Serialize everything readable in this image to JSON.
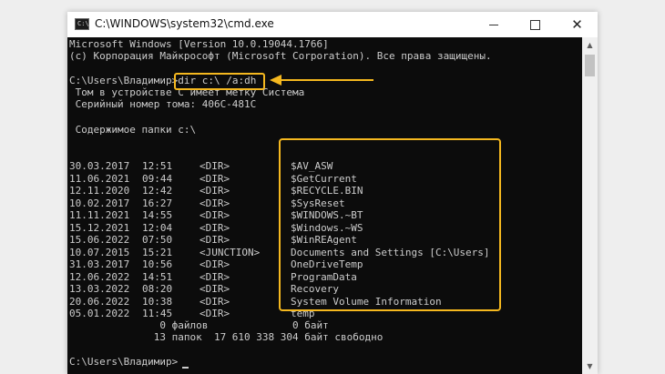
{
  "window": {
    "title": "C:\\WINDOWS\\system32\\cmd.exe",
    "icon": "console-icon",
    "icon_text": "C:\\",
    "controls": {
      "minimize": "minimize-icon",
      "maximize": "maximize-icon",
      "close": "✕"
    }
  },
  "console": {
    "header": [
      "Microsoft Windows [Version 10.0.19044.1766]",
      "(c) Корпорация Майкрософт (Microsoft Corporation). Все права защищены."
    ],
    "command_prompt": "C:\\Users\\Владимир>",
    "command": "dir c:\\ /a:dh",
    "volume_info": [
      " Том в устройстве C имеет метку Система",
      " Серийный номер тома: 406C-481C"
    ],
    "folder_header": " Содержимое папки c:\\",
    "entries": [
      {
        "date": "30.03.2017",
        "time": "12:51",
        "type": "<DIR>",
        "name": "$AV_ASW"
      },
      {
        "date": "11.06.2021",
        "time": "09:44",
        "type": "<DIR>",
        "name": "$GetCurrent"
      },
      {
        "date": "12.11.2020",
        "time": "12:42",
        "type": "<DIR>",
        "name": "$RECYCLE.BIN"
      },
      {
        "date": "10.02.2017",
        "time": "16:27",
        "type": "<DIR>",
        "name": "$SysReset"
      },
      {
        "date": "11.11.2021",
        "time": "14:55",
        "type": "<DIR>",
        "name": "$WINDOWS.~BT"
      },
      {
        "date": "15.12.2021",
        "time": "12:04",
        "type": "<DIR>",
        "name": "$Windows.~WS"
      },
      {
        "date": "15.06.2022",
        "time": "07:50",
        "type": "<DIR>",
        "name": "$WinREAgent"
      },
      {
        "date": "10.07.2015",
        "time": "15:21",
        "type": "<JUNCTION>",
        "name": "Documents and Settings [C:\\Users]"
      },
      {
        "date": "31.03.2017",
        "time": "10:56",
        "type": "<DIR>",
        "name": "OneDriveTemp"
      },
      {
        "date": "12.06.2022",
        "time": "14:51",
        "type": "<DIR>",
        "name": "ProgramData"
      },
      {
        "date": "13.03.2022",
        "time": "08:20",
        "type": "<DIR>",
        "name": "Recovery"
      },
      {
        "date": "20.06.2022",
        "time": "10:38",
        "type": "<DIR>",
        "name": "System Volume Information"
      },
      {
        "date": "05.01.2022",
        "time": "11:45",
        "type": "<DIR>",
        "name": "temp"
      }
    ],
    "summary_files": "               0 файлов              0 байт",
    "summary_dirs": "              13 папок  17 610 338 304 байт свободно",
    "final_prompt": "C:\\Users\\Владимир>"
  },
  "scrollbar": {
    "up": "▲",
    "down": "▼"
  },
  "annotation": {
    "color": "#f5b81f",
    "arrow": "left-arrow-icon"
  }
}
